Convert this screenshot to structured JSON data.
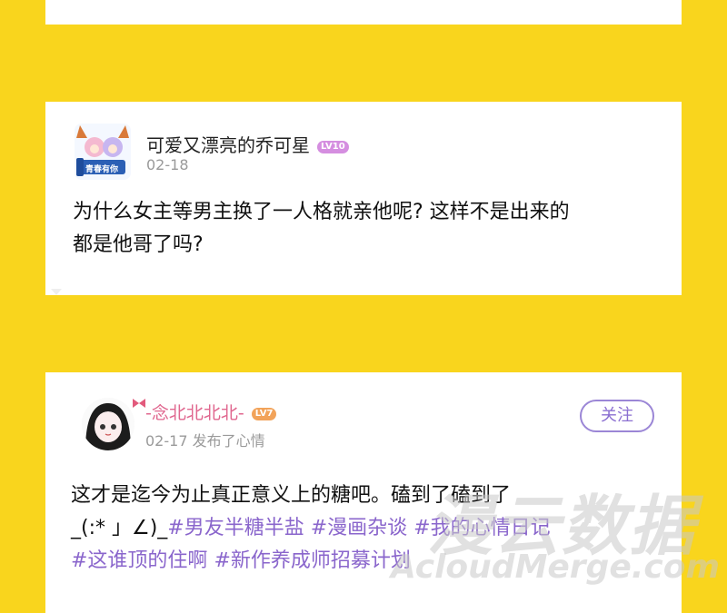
{
  "posts": [
    {
      "username": "可爱又漂亮的乔可星",
      "level": "LV10",
      "date": "02-18",
      "content_line1": "为什么女主等男主换了一人格就亲他呢? 这样不是出来的",
      "content_line2": "都是他哥了吗?",
      "avatar_label": "青春有你"
    },
    {
      "username": "-念北北北北-",
      "level": "LV7",
      "meta": "02-17 发布了心情",
      "follow_label": "关注",
      "content_line1": "这才是迄今为止真正意义上的糖吧。磕到了磕到了",
      "content_emoticon": "_(:* 」∠)_",
      "tags": [
        "#男友半糖半盐",
        "#漫画杂谈",
        "#我的心情日记",
        "#这谁顶的住啊",
        "#新作养成师招募计划"
      ]
    }
  ],
  "watermark": {
    "cn": "漫云数据",
    "en": "AcloudMerge.com"
  }
}
